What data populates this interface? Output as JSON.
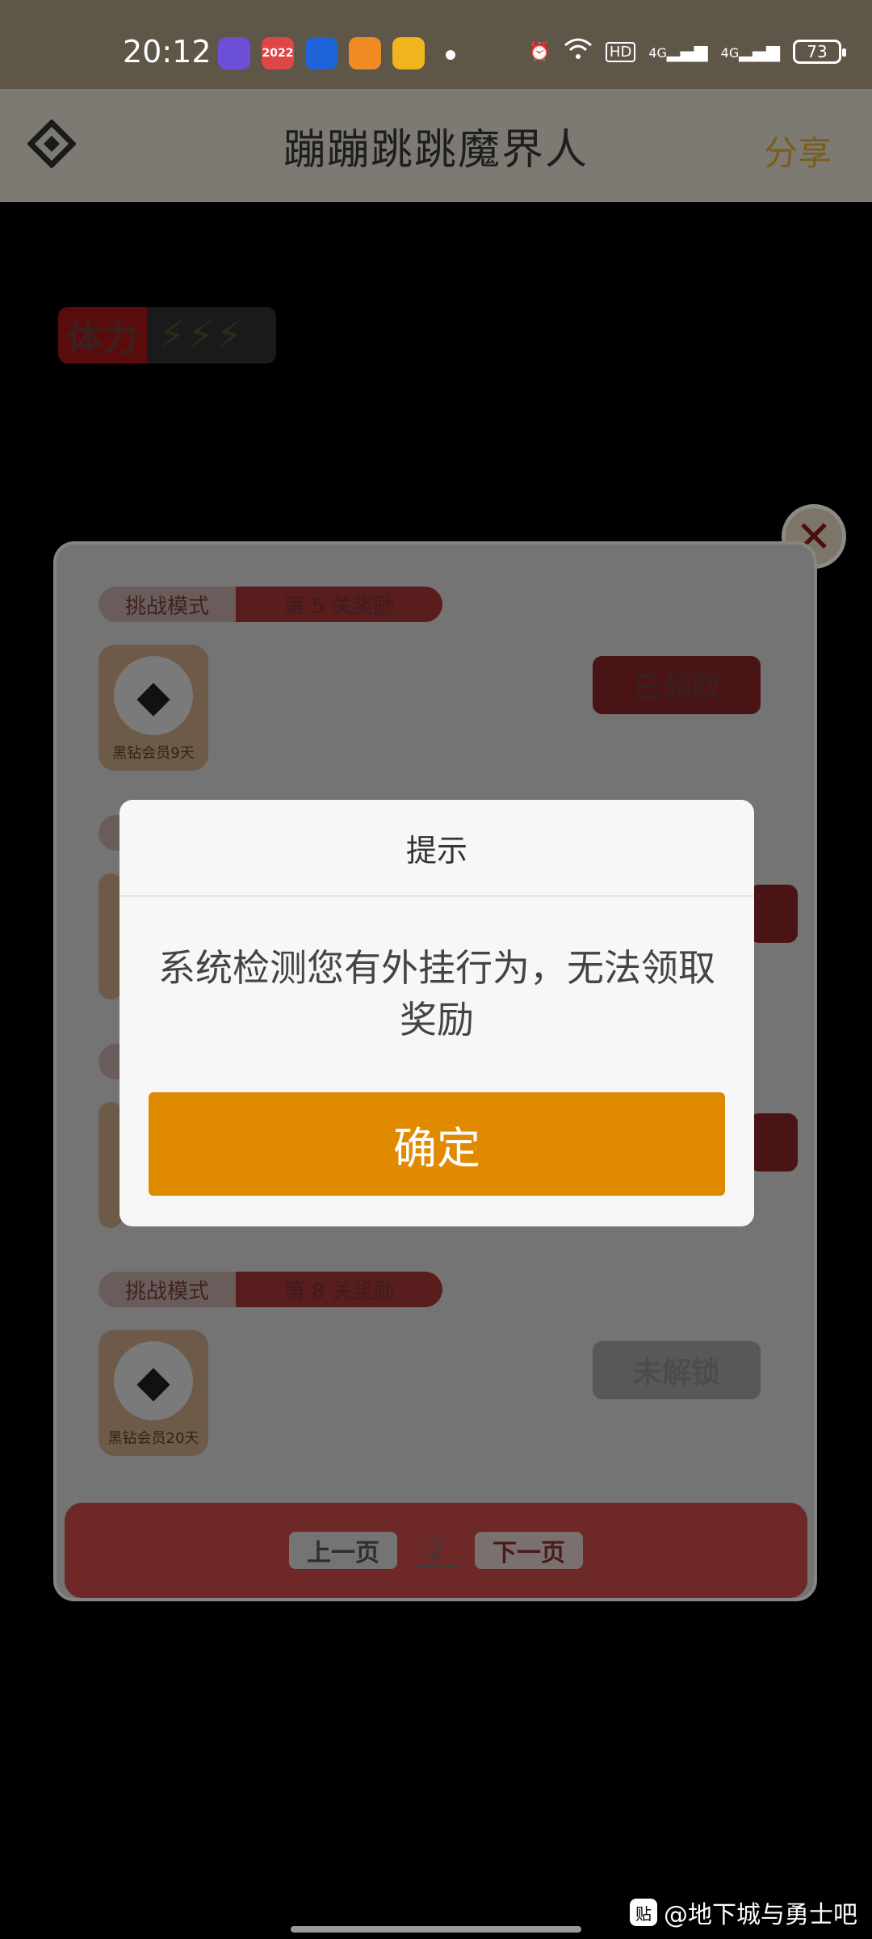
{
  "status_bar": {
    "time": "20:12",
    "apps": [
      {
        "icon": "app-1-icon",
        "color": "#6b4fd6",
        "text": ""
      },
      {
        "icon": "app-2-icon",
        "color": "#e04646",
        "text": "2022"
      },
      {
        "icon": "app-3-icon",
        "color": "#1e64d8",
        "text": ""
      },
      {
        "icon": "app-4-icon",
        "color": "#f08a24",
        "text": ""
      },
      {
        "icon": "app-5-icon",
        "color": "#f0b41e",
        "text": ""
      }
    ],
    "network_1": "4G",
    "network_2": "4G",
    "hd": "HD",
    "battery": "73"
  },
  "header": {
    "title": "蹦蹦跳跳魔界人",
    "share_label": "分享"
  },
  "game": {
    "stamina_label": "体力",
    "stamina_bolts": "⚡⚡⚡",
    "rewards": [
      {
        "mode": "挑战模式",
        "level": "第 5 关奖励",
        "item": "黑钻会员9天",
        "state": "已领取",
        "state_type": "claimed"
      },
      {
        "mode": "挑战模式",
        "level": "第 8 关奖励",
        "item": "黑钻会员20天",
        "state": "未解锁",
        "state_type": "locked"
      }
    ],
    "pager": {
      "prev": "上一页",
      "page": "2",
      "next": "下一页"
    }
  },
  "dialog": {
    "title": "提示",
    "message": "系统检测您有外挂行为，无法领取奖励",
    "ok_label": "确定"
  },
  "watermark": {
    "text": "@地下城与勇士吧",
    "icon": "tieba-icon"
  }
}
